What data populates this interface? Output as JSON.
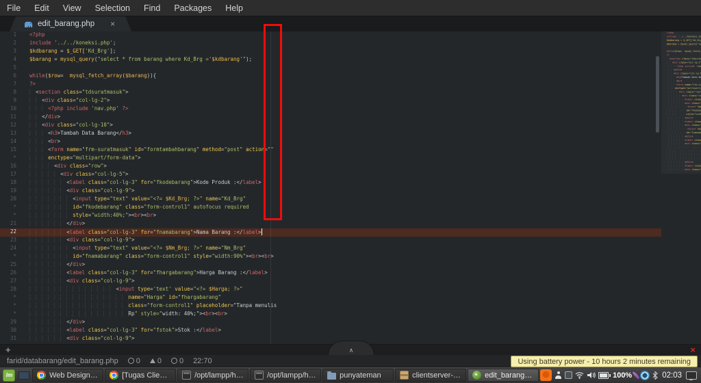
{
  "menu_bar": {
    "items": [
      "File",
      "Edit",
      "View",
      "Selection",
      "Find",
      "Packages",
      "Help"
    ]
  },
  "tab_bar": {
    "active_tab": {
      "icon": "php-elephant-icon",
      "label": "edit_barang.php",
      "close_glyph": "×"
    }
  },
  "editor": {
    "active_line": 22,
    "wrap_guide_column": 80,
    "rows": [
      {
        "n": "1",
        "t": "<?php"
      },
      {
        "n": "2",
        "t": "include '../../koneksi.php';"
      },
      {
        "n": "3",
        "t": "$kdbarang = $_GET['Kd_Brg'];"
      },
      {
        "n": "4",
        "t": "$barang = mysql_query(\"select * from barang where Kd_Brg ='$kdbarang'\");"
      },
      {
        "n": "5",
        "t": ""
      },
      {
        "n": "6",
        "t": "while($row=  mysql_fetch_array($barang)){"
      },
      {
        "n": "7",
        "t": "?>"
      },
      {
        "n": "8",
        "t": "  <section class=\"tdsuratmasuk\">"
      },
      {
        "n": "9",
        "t": "    <div class=\"col-lg-2\">"
      },
      {
        "n": "10",
        "t": "      <?php include 'nav.php' ?>"
      },
      {
        "n": "11",
        "t": "    </div>"
      },
      {
        "n": "12",
        "t": "    <div class=\"col-lg-10\">"
      },
      {
        "n": "13",
        "t": "      <h3>Tambah Data Barang</h3>"
      },
      {
        "n": "14",
        "t": "      <br>"
      },
      {
        "n": "15",
        "t": "      <form name=\"frm-suratmasuk\" id=\"formtambahbarang\" method=\"post\" action=\"\""
      },
      {
        "n": "*",
        "t": "      enctype=\"multipart/form-data\">"
      },
      {
        "n": "16",
        "t": "        <div class=\"row\">"
      },
      {
        "n": "17",
        "t": "          <div class=\"col-lg-5\">"
      },
      {
        "n": "18",
        "t": "            <label class=\"col-lg-3\" for=\"fkodebarang\">Kode Produk :</label>"
      },
      {
        "n": "19",
        "t": "            <div class=\"col-lg-9\">"
      },
      {
        "n": "20",
        "t": "              <input type=\"text\" value=\"<?= $Kd_Brg; ?>\" name=\"Kd_Brg\""
      },
      {
        "n": "*",
        "t": "              id=\"fkodebarang\" class=\"form-control1\" autofocus required"
      },
      {
        "n": "*",
        "t": "              style=\"width:40%;\"><br><br>"
      },
      {
        "n": "21",
        "t": "            </div>"
      },
      {
        "n": "22",
        "t": "            <label class=\"col-lg-3\" for=\"fnamabarang\">Nama Barang :</label>",
        "active": true,
        "cursor": true
      },
      {
        "n": "23",
        "t": "            <div class=\"col-lg-9\">"
      },
      {
        "n": "24",
        "t": "              <input type=\"text\" value=\"<?= $Nm_Brg; ?>\" name=\"Nm_Brg\""
      },
      {
        "n": "*",
        "t": "              id=\"fnamabarang\" class=\"form-control1\" style=\"width:90%\"><br><br>"
      },
      {
        "n": "25",
        "t": "            </div>"
      },
      {
        "n": "26",
        "t": "            <label class=\"col-lg-3\" for=\"fhargabarang\">Harga Barang :</label>"
      },
      {
        "n": "27",
        "t": "            <div class=\"col-lg-9\">"
      },
      {
        "n": "28",
        "t": "                            <input type='text' value=\"<?= $Harga; ?>\""
      },
      {
        "n": "*",
        "t": "                                name=\"Harga\" id=\"fhargabarang\""
      },
      {
        "n": "*",
        "t": "                                class=\"form-control1\" placeholder=\"Tanpa menulis"
      },
      {
        "n": "*",
        "t": "                                Rp\" style=\"width: 40%;\"><br><br>"
      },
      {
        "n": "29",
        "t": "            </div>"
      },
      {
        "n": "30",
        "t": "            <label class=\"col-lg-3\" for=\"fstok\">Stok :</label>"
      },
      {
        "n": "31",
        "t": "            <div class=\"col-lg-9\">"
      }
    ]
  },
  "bottom_strip": {
    "add_label": "+",
    "reveal_chevron": "∧",
    "close_glyph": "×"
  },
  "status_bar": {
    "file_path": "farid/databarang/edit_barang.php",
    "counts": [
      {
        "icon": "error-circle-icon",
        "value": "0"
      },
      {
        "icon": "warning-triangle-icon",
        "value": "0"
      },
      {
        "icon": "info-circle-icon",
        "value": "0"
      }
    ],
    "cursor_position": "22:70"
  },
  "tooltip": {
    "text": "Using battery power - 10 hours 2 minutes remaining"
  },
  "taskbar": {
    "menu_button_label": "lm",
    "windows": [
      {
        "icon": "chrome-icon",
        "label": "Web Designer In..."
      },
      {
        "icon": "chrome-icon",
        "label": "[Tugas Client Ser..."
      },
      {
        "icon": "terminal-icon",
        "label": "/opt/lampp/htdoc..."
      },
      {
        "icon": "terminal-icon",
        "label": "/opt/lampp/htdo..."
      },
      {
        "icon": "folder-icon",
        "label": "punyateman"
      },
      {
        "icon": "archive-icon",
        "label": "clientserver-san..."
      },
      {
        "icon": "atom-icon",
        "label": "edit_barang.php ...",
        "active": true
      }
    ],
    "tray": {
      "battery_percent": "100%",
      "clock": "02:03"
    }
  },
  "colors": {
    "annotation_rectangle": "#f10c0c",
    "editor_background": "#24272a",
    "active_line_background": "#4e2a20",
    "tooltip_background": "#f6eeae",
    "syntax": {
      "tag": "#cc6666",
      "keyword": "#cc6666",
      "attribute": "#edc94f",
      "string": "#b0bd68",
      "variable": "#e8b84f"
    }
  }
}
